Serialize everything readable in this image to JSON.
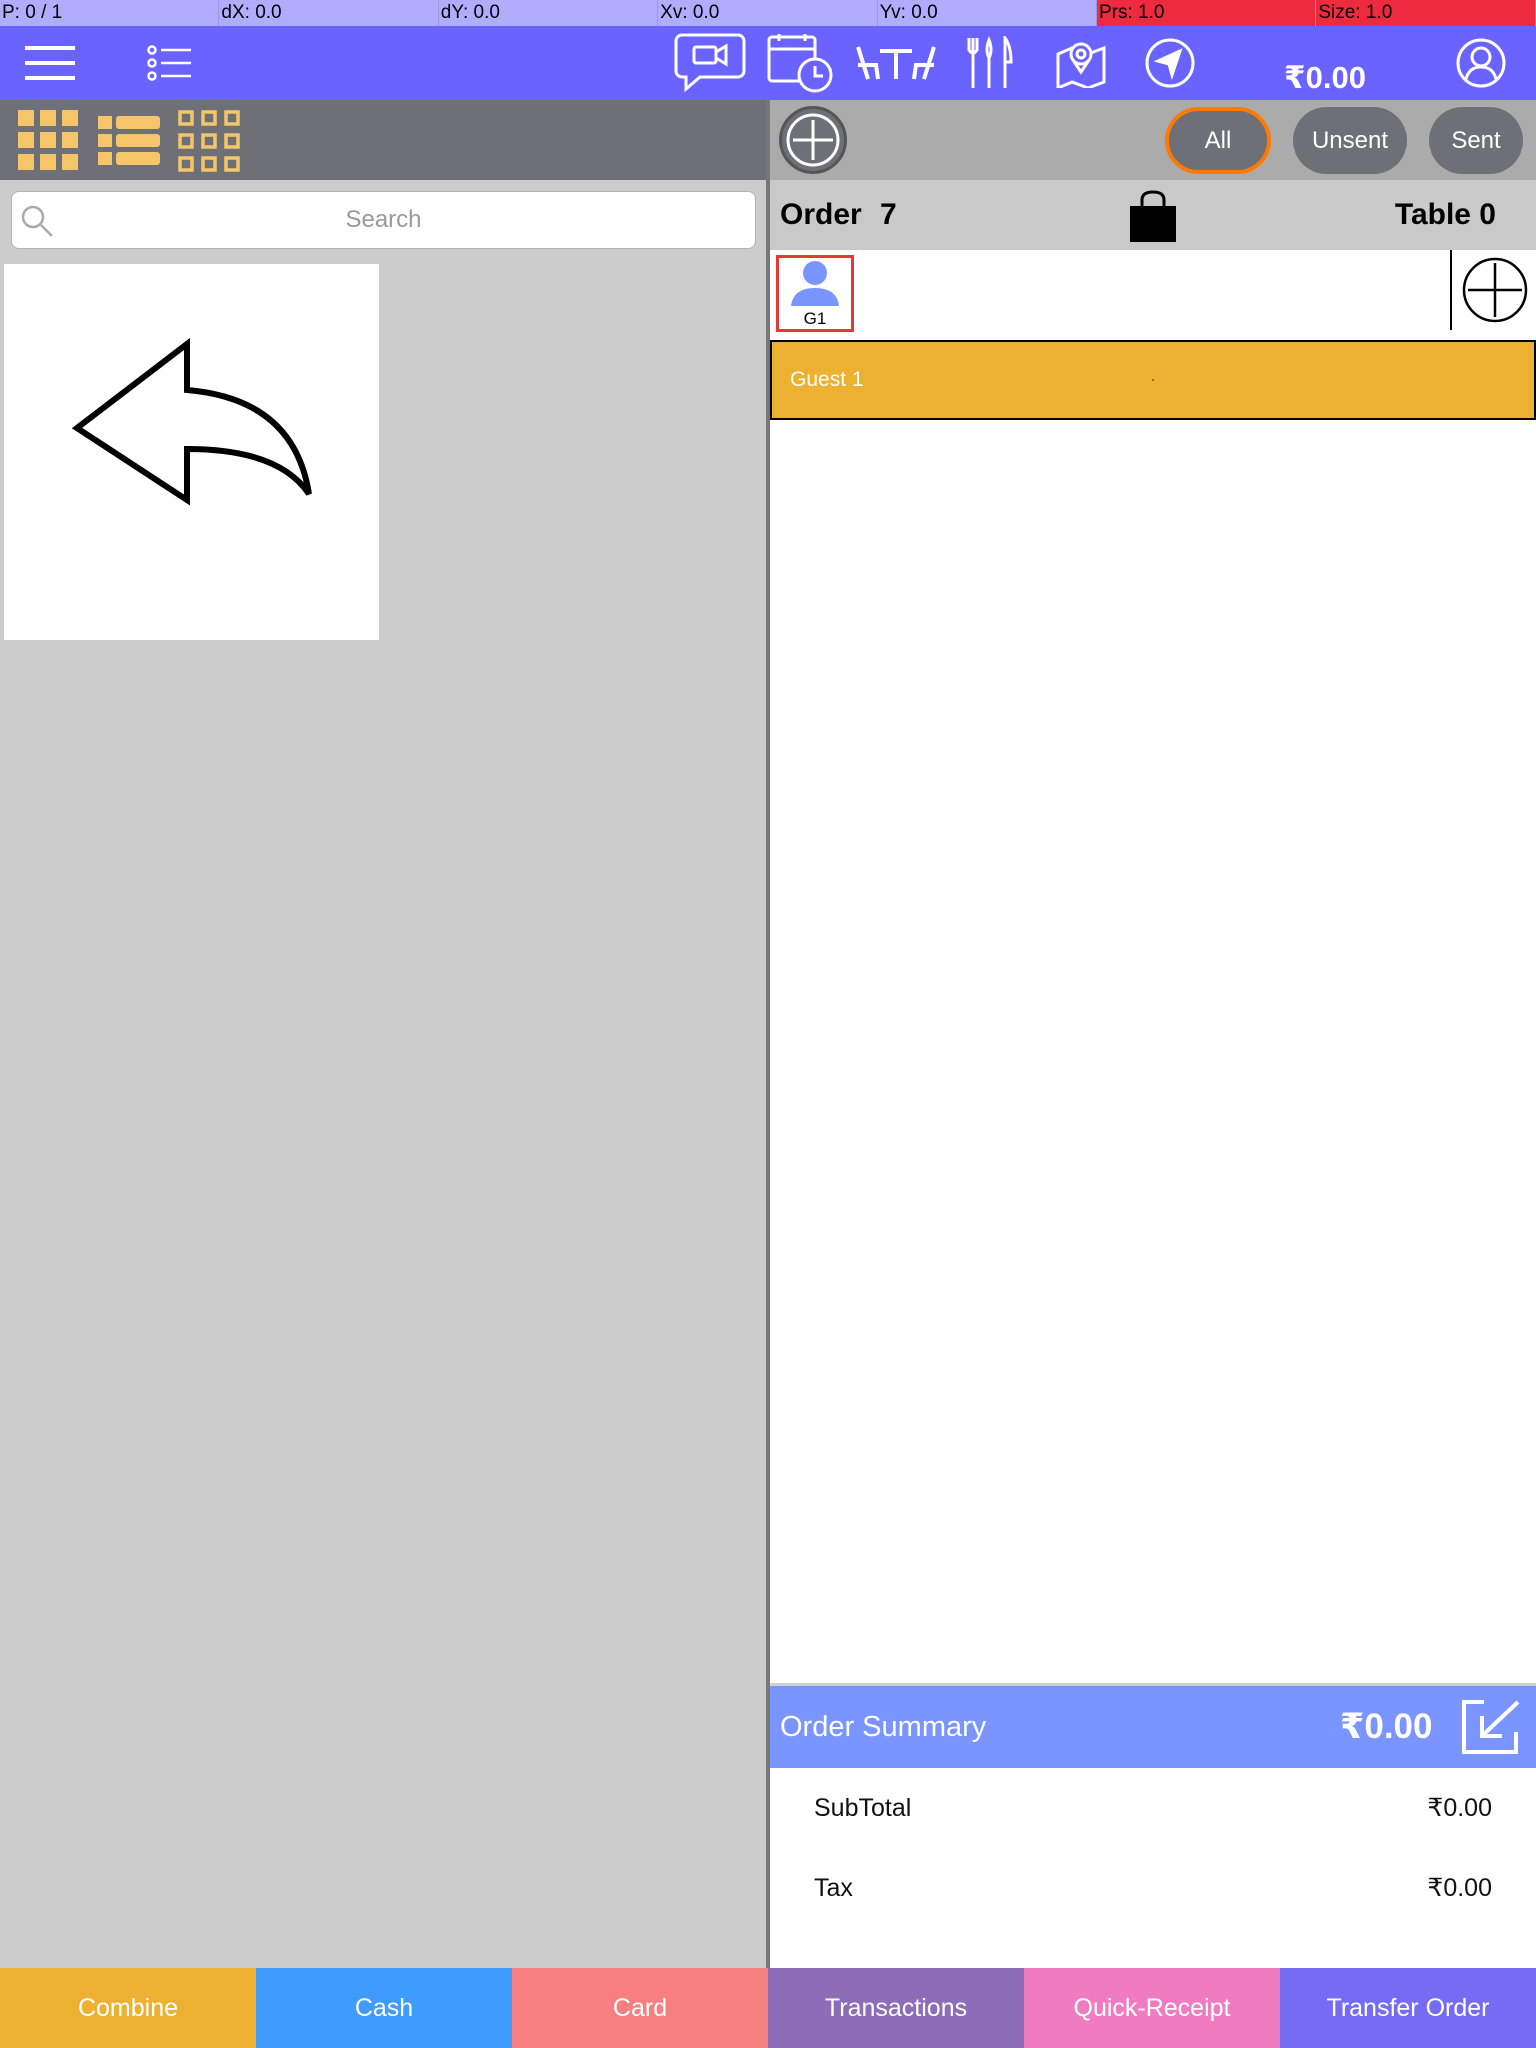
{
  "debug": {
    "pointer": "P: 0 / 1",
    "dx": "dX: 0.0",
    "dy": "dY: 0.0",
    "xv": "Xv: 0.0",
    "yv": "Yv: 0.0",
    "prs": "Prs: 1.0",
    "size": "Size: 1.0"
  },
  "topbar": {
    "balance": "₹0.00",
    "icons": [
      "menu-icon",
      "list-icon",
      "video-chat-icon",
      "schedule-icon",
      "tables-icon",
      "dining-icon",
      "map-pin-icon",
      "navigation-icon",
      "profile-icon"
    ]
  },
  "left": {
    "view_icons": [
      "grid-large-icon",
      "list-view-icon",
      "grid-small-icon"
    ],
    "search_placeholder": "Search",
    "back_tile_icon": "back-arrow-icon"
  },
  "order": {
    "filters": [
      "All",
      "Unsent",
      "Sent"
    ],
    "active_filter": "All",
    "order_label": "Order",
    "order_number": "7",
    "table_label": "Table 0",
    "guest_chip": "G1",
    "guest_row": "Guest 1"
  },
  "summary": {
    "title": "Order Summary",
    "total": "₹0.00",
    "subtotal_label": "SubTotal",
    "subtotal_value": "₹0.00",
    "tax_label": "Tax",
    "tax_value": "₹0.00"
  },
  "actions": {
    "combine": "Combine",
    "cash": "Cash",
    "card": "Card",
    "transactions": "Transactions",
    "quick_receipt": "Quick-Receipt",
    "transfer_order": "Transfer Order"
  },
  "colors": {
    "topbar": "#6b63ff",
    "accent_yellow": "#edb132",
    "summary_blue": "#7a95ff",
    "combine": "#edb132",
    "cash": "#3f9bfd",
    "card": "#f77f7f",
    "transactions": "#8e6db8",
    "quick_receipt": "#ef7cc0",
    "transfer_order": "#766cf4"
  }
}
